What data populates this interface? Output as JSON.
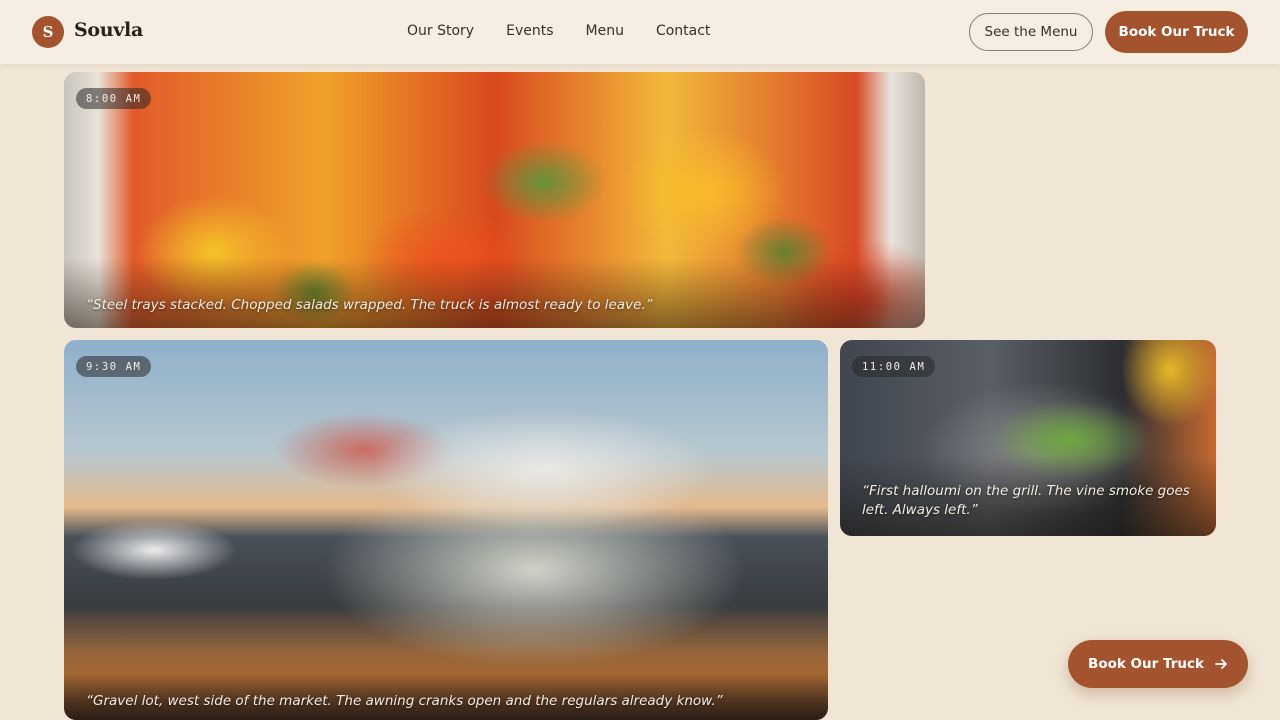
{
  "brand": {
    "initial": "S",
    "name": "Souvla"
  },
  "nav": {
    "links": [
      "Our Story",
      "Events",
      "Menu",
      "Contact"
    ]
  },
  "actions": {
    "see_menu": "See the Menu",
    "book": "Book Our Truck"
  },
  "gallery": [
    {
      "time": "8:00 AM",
      "caption": "“Steel trays stacked. Chopped salads wrapped. The truck is almost ready to leave.”"
    },
    {
      "time": "9:30 AM",
      "caption": "“Gravel lot, west side of the market. The awning cranks open and the regulars already know.”"
    },
    {
      "time": "11:00 AM",
      "caption": "“First halloumi on the grill. The vine smoke goes left. Always left.”"
    }
  ],
  "floating_cta": {
    "label": "Book Our Truck",
    "icon": "arrow-right-icon"
  },
  "colors": {
    "accent": "#a4532f",
    "background": "#f1e6d6",
    "nav_background": "#f6eee2"
  }
}
